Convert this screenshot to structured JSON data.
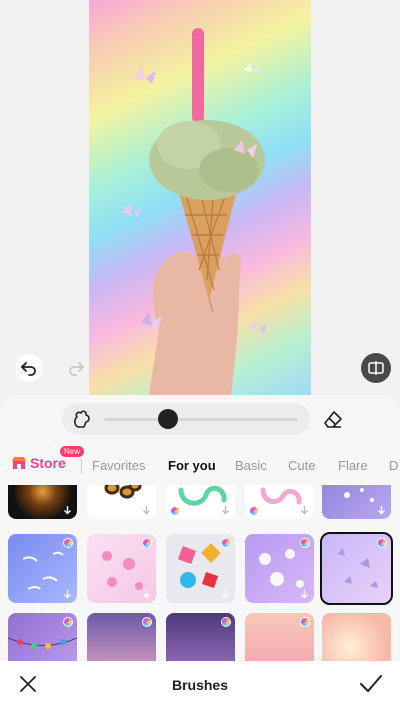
{
  "editor": {
    "undo_icon": "undo-arrow-icon",
    "redo_icon": "redo-arrow-icon",
    "compare_icon": "compare-icon"
  },
  "brush_size": {
    "level": 0.33
  },
  "tabs": {
    "store": "Store",
    "new_badge": "New",
    "items": [
      "Favorites",
      "For you",
      "Basic",
      "Cute",
      "Flare",
      "D"
    ],
    "active": "For you"
  },
  "bottom": {
    "title": "Brushes"
  },
  "colors": {
    "accent": "#ff3b8b",
    "active_text": "#111111",
    "inactive_text": "#999999"
  }
}
